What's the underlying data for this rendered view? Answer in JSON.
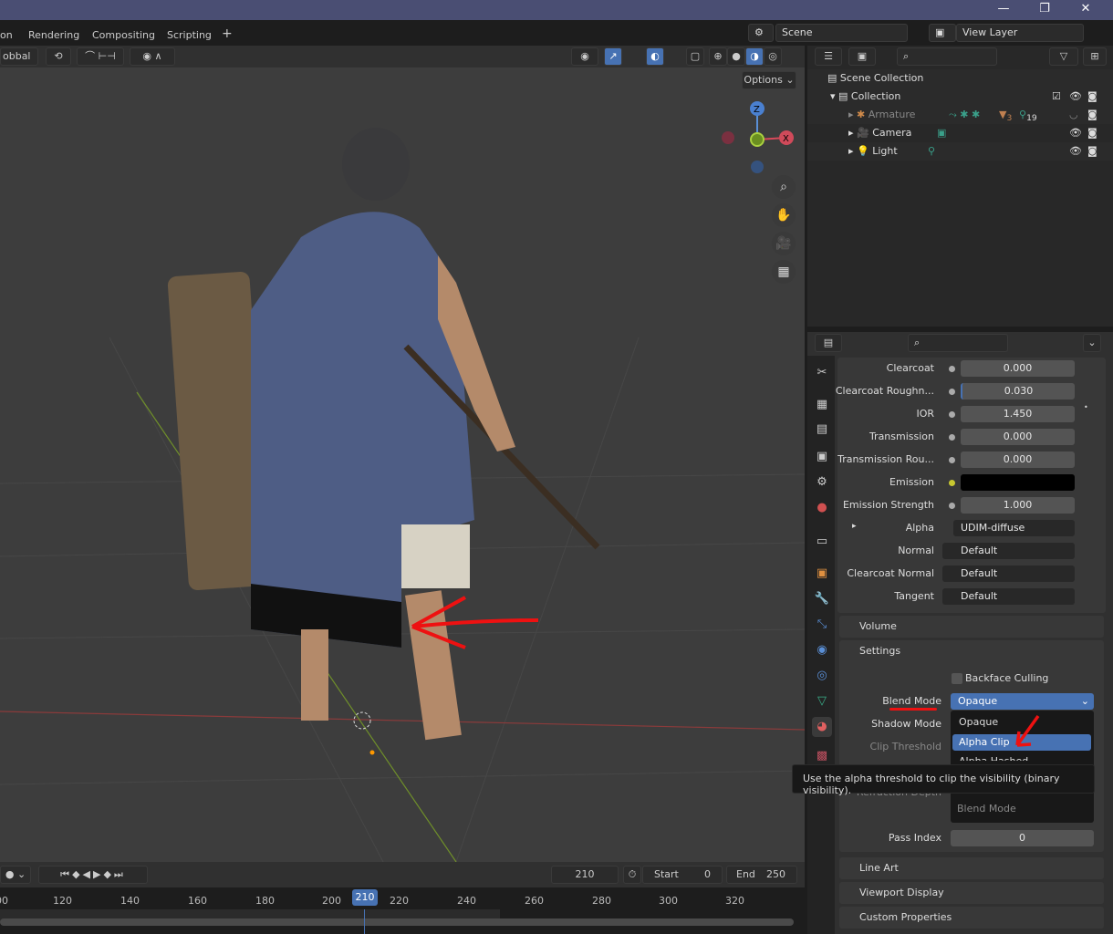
{
  "titlebar": {
    "minimize": "—",
    "maximize": "❐",
    "close": "✕"
  },
  "workspaces": [
    "on",
    "Rendering",
    "Compositing",
    "Scripting",
    "+"
  ],
  "scene": {
    "label": "Scene",
    "view_layer": "View Layer"
  },
  "viewport": {
    "transform_orientation": "obbal",
    "options_label": "Options",
    "gizmo": {
      "z": "Z",
      "x": "X"
    }
  },
  "outliner": {
    "rows": [
      {
        "name": "Scene Collection"
      },
      {
        "name": "Collection"
      },
      {
        "name": "Armature",
        "badge1": "3",
        "badge2": "19"
      },
      {
        "name": "Camera"
      },
      {
        "name": "Light"
      }
    ]
  },
  "properties": {
    "rows": [
      {
        "label": "Clearcoat",
        "value": "0.000"
      },
      {
        "label": "Clearcoat Roughn...",
        "value": "0.030"
      },
      {
        "label": "IOR",
        "value": "1.450"
      },
      {
        "label": "Transmission",
        "value": "0.000"
      },
      {
        "label": "Transmission Rou...",
        "value": "0.000"
      },
      {
        "label": "Emission",
        "value": ""
      },
      {
        "label": "Emission Strength",
        "value": "1.000"
      },
      {
        "label": "Alpha",
        "value": "UDIM-diffuse"
      },
      {
        "label": "Normal",
        "value": "Default"
      },
      {
        "label": "Clearcoat Normal",
        "value": "Default"
      },
      {
        "label": "Tangent",
        "value": "Default"
      }
    ],
    "panels": {
      "volume": "Volume",
      "settings": "Settings",
      "line_art": "Line Art",
      "viewport_display": "Viewport Display",
      "custom_properties": "Custom Properties"
    },
    "settings": {
      "backface_culling": "Backface Culling",
      "blend_mode_label": "Blend Mode",
      "blend_mode_value": "Opaque",
      "shadow_mode_label": "Shadow Mode",
      "clip_threshold_label": "Clip Threshold",
      "refraction_depth_label": "Refraction Depth",
      "pass_index_label": "Pass Index",
      "pass_index_value": "0"
    },
    "dropdown": {
      "options": [
        "Opaque",
        "Alpha Clip",
        "Alpha Hashed"
      ],
      "selected": "Alpha Clip",
      "footer": "Blend Mode"
    },
    "tooltip": "Use the alpha threshold to clip the visibility (binary visibility)."
  },
  "timeline": {
    "current_frame": "210",
    "start_label": "Start",
    "start": "0",
    "end_label": "End",
    "end": "250",
    "ticks": [
      "00",
      "120",
      "140",
      "160",
      "180",
      "200",
      "220",
      "240",
      "260",
      "280",
      "300",
      "320"
    ],
    "playhead": "210"
  }
}
